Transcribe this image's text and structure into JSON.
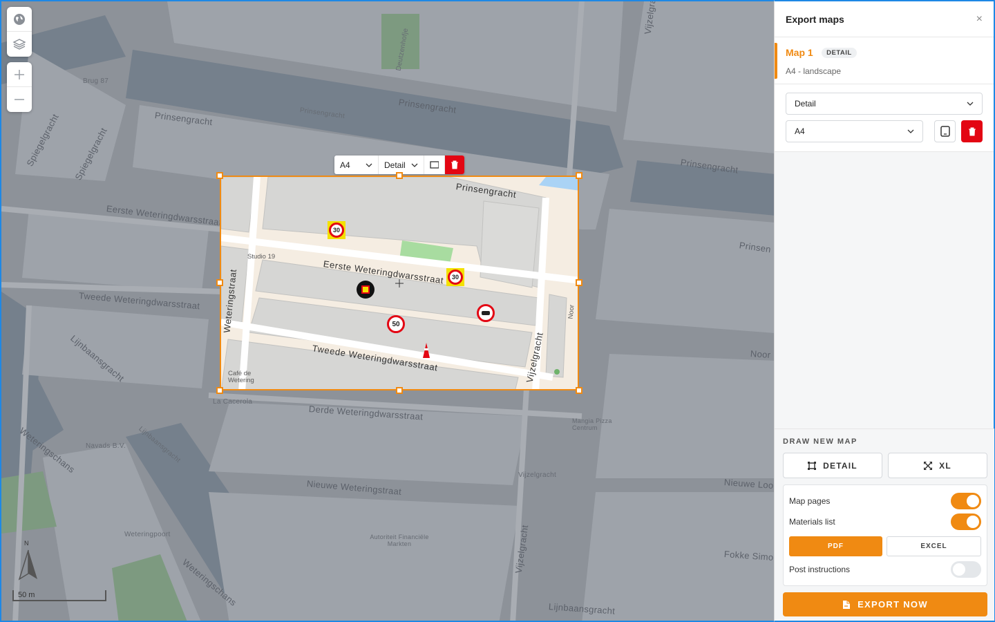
{
  "panel": {
    "title": "Export maps",
    "close": "×",
    "maps": [
      {
        "name": "Map 1",
        "badge": "DETAIL",
        "subtitle": "A4 - landscape"
      }
    ],
    "map_type_select": "Detail",
    "paper_select": "A4",
    "draw_new_map": {
      "title": "DRAW NEW MAP",
      "detail_label": "DETAIL",
      "xl_label": "XL"
    },
    "options": {
      "map_pages": {
        "label": "Map pages",
        "on": true
      },
      "materials_list": {
        "label": "Materials list",
        "on": true
      },
      "formats": [
        "PDF",
        "EXCEL"
      ],
      "selected_format": "PDF",
      "post_instructions": {
        "label": "Post instructions",
        "on": false
      }
    },
    "export_label": "EXPORT NOW"
  },
  "frame_toolbar": {
    "paper": "A4",
    "type": "Detail"
  },
  "map": {
    "scale_label": "50 m",
    "north_label": "N",
    "streets_outside": [
      "Prinsengracht",
      "Prinsengracht",
      "Prinsengracht",
      "Prinsengracht",
      "Eerste Weteringdwarsstraat",
      "Tweede Weteringdwarsstraat",
      "Derde Weteringdwarsstraat",
      "Nieuwe Weteringstraat",
      "Lijnbaansgracht",
      "Lijnbaansgracht",
      "Weteringschans",
      "Weteringschans",
      "Spiegelgracht",
      "Spiegelgracht",
      "Vijzelgracht",
      "Vijzelgracht",
      "Prinsen",
      "Noor",
      "Nieuwe Loo",
      "Fokke Simo",
      "Lijnbaansgracht",
      "Deutzenhofje",
      "Brug 87",
      "Navads B.V.",
      "Weteringpoort",
      "Autoriteit Financiële Markten",
      "Mangia Pizza Centrum",
      "Vijzelgracht",
      "La Cacerola"
    ],
    "streets_inside": [
      "Prinsengracht",
      "Eerste Weteringdwarsstraat",
      "Tweede Weteringdwarsstraat",
      "Weteringstraat",
      "Vijzelgracht",
      "Studio 19",
      "Café de Wetering",
      "Noor"
    ],
    "signs": [
      "30",
      "30",
      "50"
    ]
  }
}
